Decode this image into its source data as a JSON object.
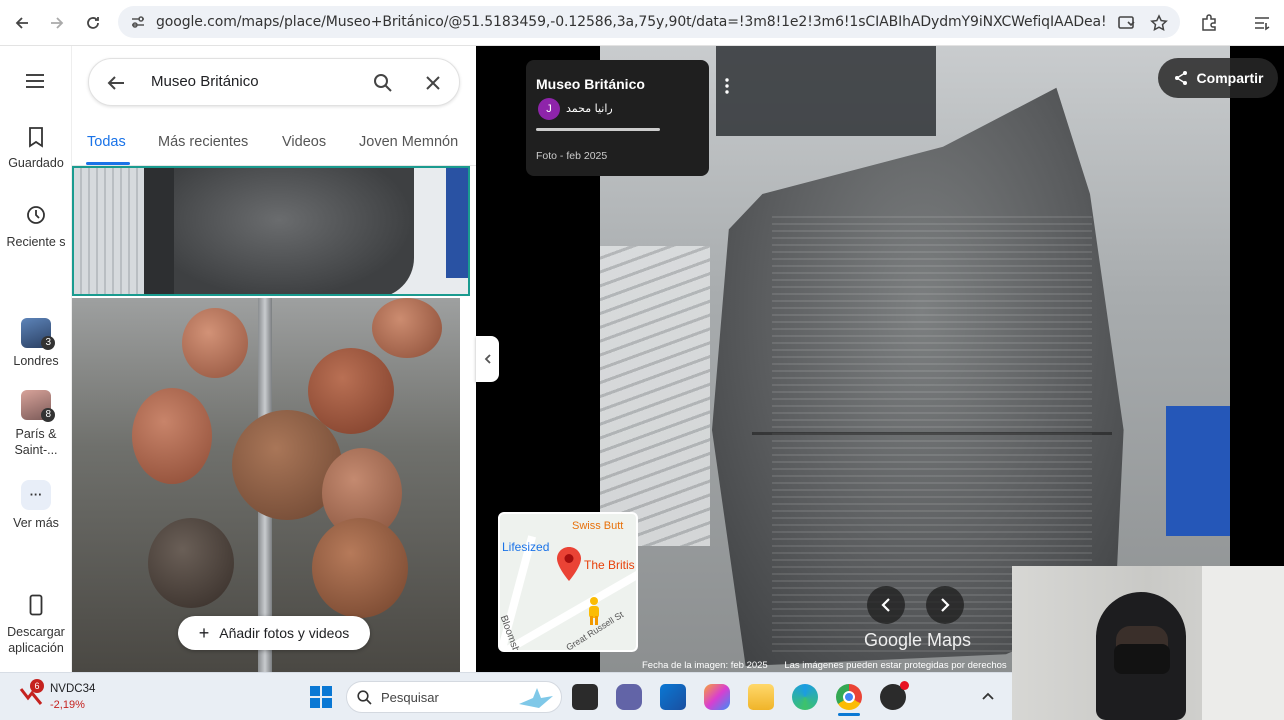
{
  "browser": {
    "url": "google.com/maps/place/Museo+Británico/@51.5183459,-0.12586,3a,75y,90t/data=!3m8!1e2!3m6!1sCIABIhADydmY9iNXCWefiqIAADea!2e10!3e12!6shttp..."
  },
  "rail": {
    "items": [
      {
        "label": "Guardado",
        "icon": "bookmark-icon"
      },
      {
        "label": "Reciente s",
        "icon": "history-icon"
      },
      {
        "label": "Londres",
        "badge": "3"
      },
      {
        "label": "París & Saint-...",
        "badge": "8"
      },
      {
        "label": "Ver más",
        "icon": "more-icon"
      },
      {
        "label": "Descargar aplicación",
        "icon": "phone-icon"
      }
    ]
  },
  "search": {
    "query": "Museo Británico"
  },
  "tabs": [
    "Todas",
    "Más recientes",
    "Videos",
    "Joven Memnón"
  ],
  "panel": {
    "add_photos_label": "Añadir fotos y videos"
  },
  "viewer": {
    "title": "Museo Británico",
    "author_initial": "J",
    "author_name": "رانيا محمد",
    "date": "Foto - feb 2025",
    "share_label": "Compartir",
    "logo_text": "Google Maps",
    "footer_date": "Fecha de la imagen: feb 2025",
    "footer_rights": "Las imágenes pueden estar protegidas por derechos",
    "minimap": {
      "labels": [
        "Swiss Butt",
        "Lifesized",
        "The Britis",
        "Bloomsbury",
        "Great Russell St"
      ]
    }
  },
  "taskbar": {
    "ticker": "NVDC34",
    "ticker_change": "-2,19%",
    "notification_count": "6",
    "search_placeholder": "Pesquisar"
  },
  "colors": {
    "accent": "#1a73e8",
    "pin": "#ea4335",
    "ticker_down": "#c5221f"
  }
}
